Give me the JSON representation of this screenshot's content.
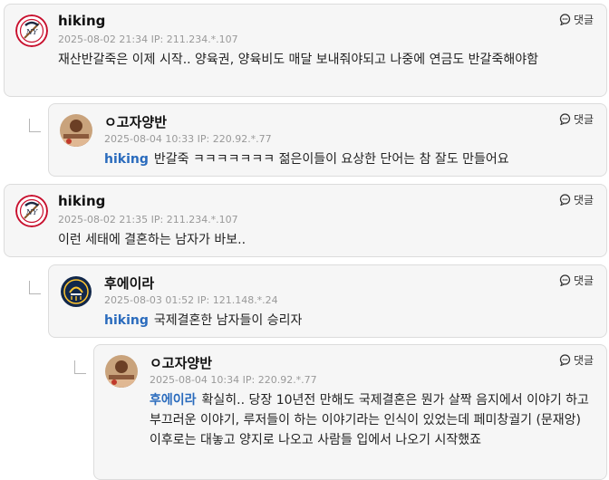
{
  "reply_label": "댓글",
  "comments": [
    {
      "nick": "hiking",
      "meta": "2025-08-02 21:34  IP: 211.234.*.107",
      "mention": "",
      "text": "재산반갈죽은 이제 시작.. 양육권, 양육비도 매달 보내줘야되고 나중에 연금도 반갈죽해야함",
      "avatar": "yankees-logo"
    },
    {
      "nick": "ㅇ고자양반",
      "meta": "2025-08-04 10:33  IP: 220.92.*.77",
      "mention": "hiking",
      "text": "반갈죽 ㅋㅋㅋㅋㅋㅋㅋ 젊은이들이 요상한 단어는 참 잘도 만들어요",
      "avatar": "photo-avatar"
    },
    {
      "nick": "hiking",
      "meta": "2025-08-02 21:35  IP: 211.234.*.107",
      "mention": "",
      "text": "이런 세태에 결혼하는 남자가 바보..",
      "avatar": "yankees-logo"
    },
    {
      "nick": "후에이라",
      "meta": "2025-08-03 01:52  IP: 121.148.*.24",
      "mention": "hiking",
      "text": "국제결혼한 남자들이 승리자",
      "avatar": "brewers-logo"
    },
    {
      "nick": "ㅇ고자양반",
      "meta": "2025-08-04 10:34  IP: 220.92.*.77",
      "mention": "후에이라",
      "text": "확실히.. 당장 10년전 만해도 국제결혼은 뭔가 살짝 음지에서 이야기 하고 부끄러운 이야기, 루저들이 하는 이야기라는 인식이 있었는데 페미창궐기 (문재앙) 이후로는 대놓고 양지로 나오고 사람들 입에서 나오기 시작했죠",
      "avatar": "photo-avatar"
    }
  ],
  "colors": {
    "mention": "#2a6bbd",
    "card_bg": "#f6f6f6",
    "card_border": "#dcdcdc",
    "yankees_red": "#c8102e",
    "brewers_navy": "#12284b",
    "brewers_gold": "#ffc52f"
  }
}
